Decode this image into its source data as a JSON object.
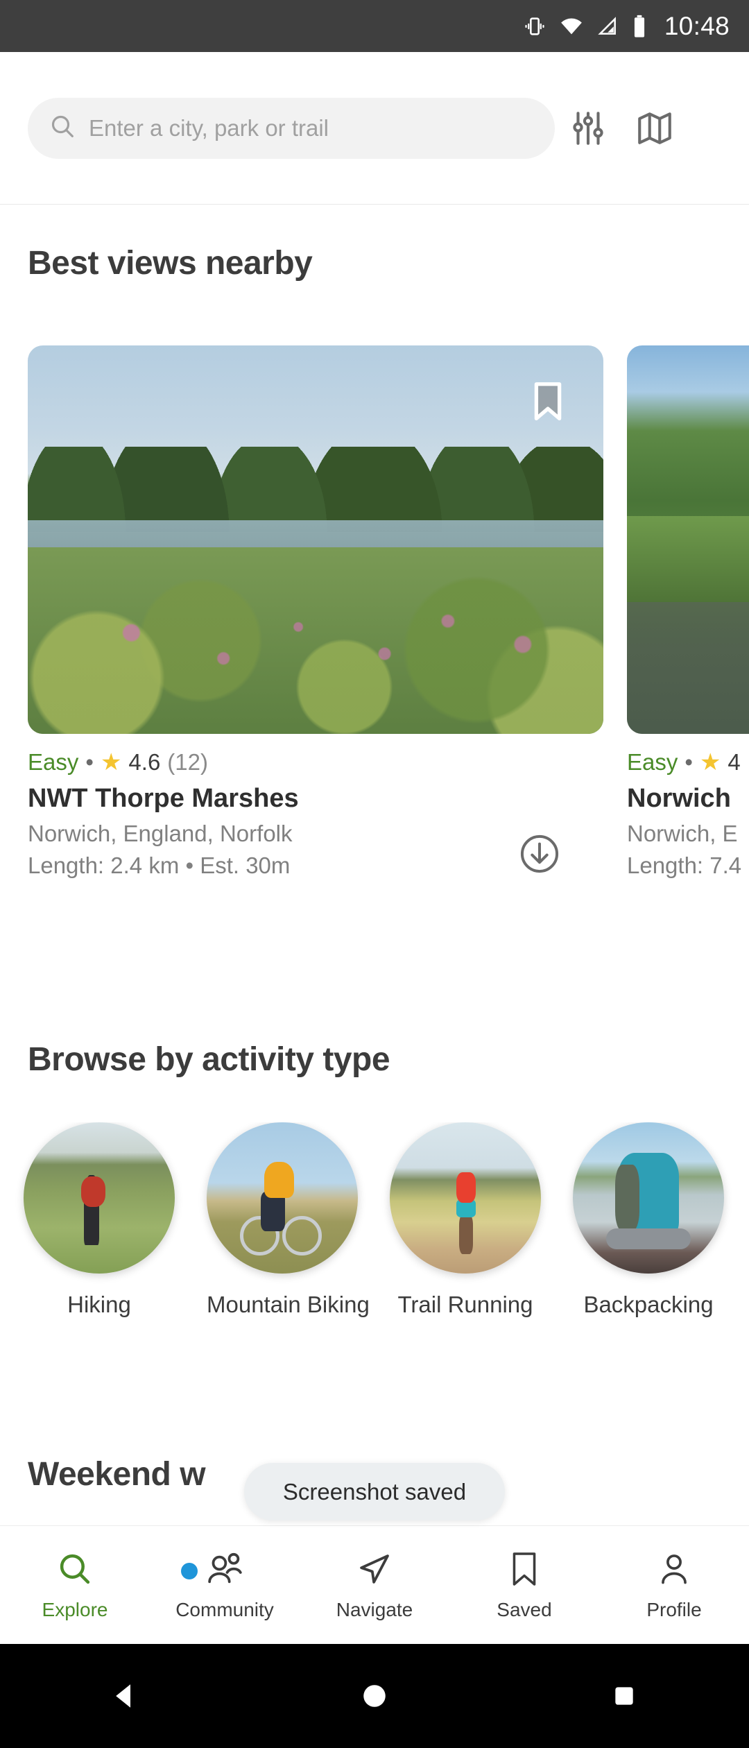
{
  "status_bar": {
    "time": "10:48",
    "icons": [
      "vibrate-icon",
      "wifi-icon",
      "cellular-signal-icon",
      "battery-icon"
    ]
  },
  "header": {
    "search_placeholder": "Enter a city, park or trail",
    "search_value": "",
    "filter_icon": "sliders-icon",
    "map_icon": "map-icon"
  },
  "sections": {
    "best_views_title": "Best views nearby",
    "browse_title": "Browse by activity type",
    "weekend_title": "Weekend w"
  },
  "trail_cards": [
    {
      "difficulty": "Easy",
      "separator": "•",
      "star": "★",
      "rating": "4.6",
      "rating_count": "(12)",
      "name": "NWT Thorpe Marshes",
      "location": "Norwich, England, Norfolk",
      "length": "Length: 2.4 km • Est. 30m",
      "bookmark_icon": "bookmark-icon",
      "download_icon": "download-icon"
    },
    {
      "difficulty": "Easy",
      "separator": "•",
      "star": "★",
      "rating": "4",
      "rating_count": "",
      "name": "Norwich",
      "location": "Norwich, E",
      "length": "Length: 7.4",
      "bookmark_icon": "bookmark-icon",
      "download_icon": "download-icon"
    }
  ],
  "activities": [
    {
      "label": "Hiking"
    },
    {
      "label": "Mountain Biking"
    },
    {
      "label": "Trail Running"
    },
    {
      "label": "Backpacking"
    }
  ],
  "toast": {
    "message": "Screenshot saved"
  },
  "bottom_nav": [
    {
      "label": "Explore",
      "icon": "search-icon",
      "active": true,
      "badge": false
    },
    {
      "label": "Community",
      "icon": "people-icon",
      "active": false,
      "badge": true
    },
    {
      "label": "Navigate",
      "icon": "navigate-icon",
      "active": false,
      "badge": false
    },
    {
      "label": "Saved",
      "icon": "bookmark-icon",
      "active": false,
      "badge": false
    },
    {
      "label": "Profile",
      "icon": "person-icon",
      "active": false,
      "badge": false
    }
  ],
  "android_nav": {
    "back": "back-triangle-icon",
    "home": "home-circle-icon",
    "recents": "recents-square-icon"
  },
  "colors": {
    "accent_green": "#4a8b28",
    "star_yellow": "#f4c430",
    "badge_blue": "#1f95d9",
    "status_bar": "#3f3f3f",
    "text_dark": "#3c3c3c",
    "text_muted": "#808080"
  }
}
